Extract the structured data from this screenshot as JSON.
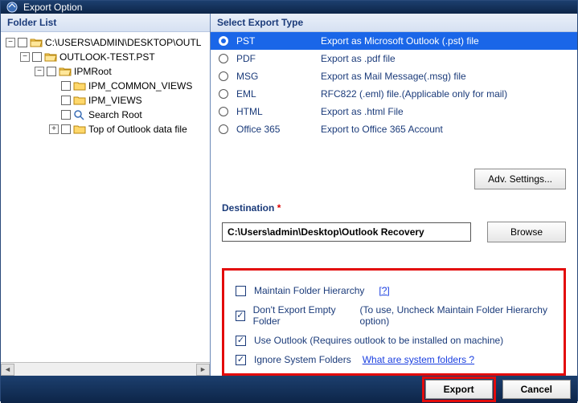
{
  "title": "Export Option",
  "left": {
    "header": "Folder List",
    "tree": {
      "root": "C:\\USERS\\ADMIN\\DESKTOP\\OUTL",
      "pst": "OUTLOOK-TEST.PST",
      "ipmroot": "IPMRoot",
      "common": "IPM_COMMON_VIEWS",
      "views": "IPM_VIEWS",
      "search": "Search Root",
      "top": "Top of Outlook data file"
    }
  },
  "right": {
    "header": "Select Export Type",
    "types": [
      {
        "name": "PST",
        "desc": "Export as Microsoft Outlook (.pst) file",
        "selected": true
      },
      {
        "name": "PDF",
        "desc": "Export as .pdf file",
        "selected": false
      },
      {
        "name": "MSG",
        "desc": "Export as Mail Message(.msg) file",
        "selected": false
      },
      {
        "name": "EML",
        "desc": "RFC822 (.eml) file.(Applicable only for mail)",
        "selected": false
      },
      {
        "name": "HTML",
        "desc": "Export as .html File",
        "selected": false
      },
      {
        "name": "Office 365",
        "desc": "Export to Office 365 Account",
        "selected": false
      }
    ],
    "adv_settings": "Adv. Settings...",
    "destination_label": "Destination",
    "destination_value": "C:\\Users\\admin\\Desktop\\Outlook Recovery",
    "browse": "Browse",
    "options": {
      "maintain": "Maintain Folder Hierarchy",
      "maintain_q": "[?]",
      "noempty": "Don't Export Empty Folder",
      "noempty_hint": "(To use, Uncheck Maintain Folder Hierarchy option)",
      "useoutlook": "Use Outlook (Requires outlook to be installed on machine)",
      "ignoresys": "Ignore System Folders",
      "ignoresys_link": "What are system folders ?"
    }
  },
  "footer": {
    "export": "Export",
    "cancel": "Cancel"
  }
}
